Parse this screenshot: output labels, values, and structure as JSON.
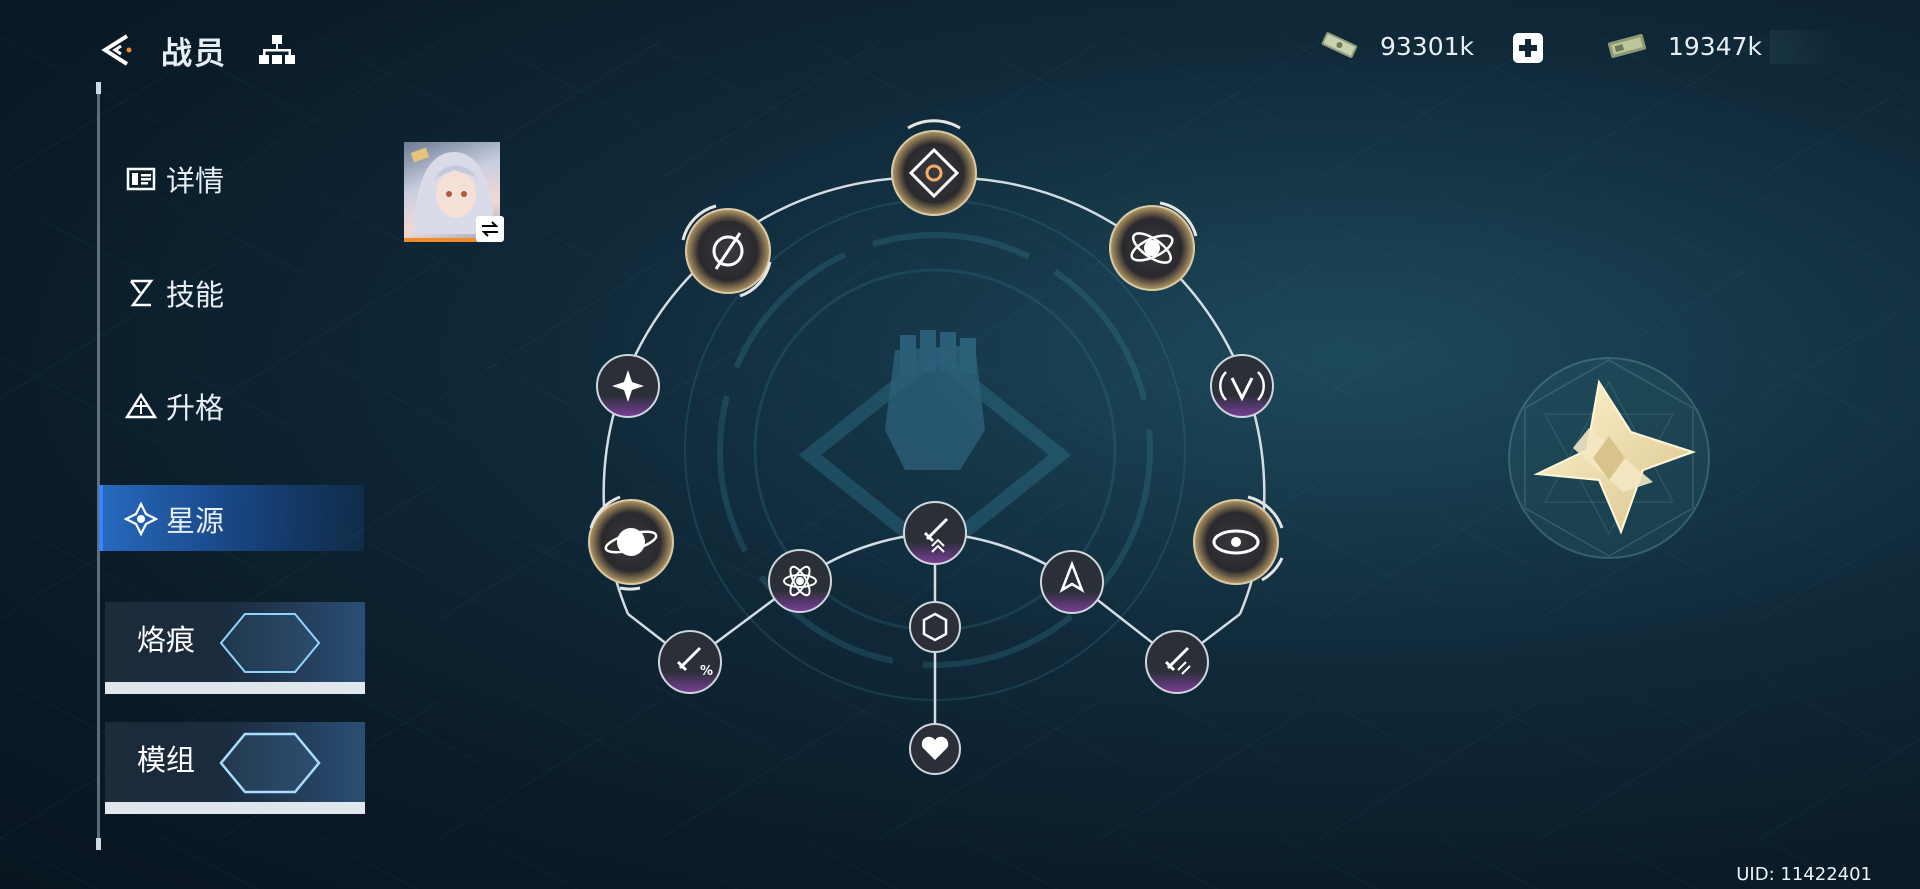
{
  "header": {
    "title": "战员",
    "back_icon": "back-arrow-icon",
    "tree_icon": "hierarchy-icon"
  },
  "currency": {
    "primary": {
      "icon": "cash-bundle-icon",
      "value": "93301k"
    },
    "secondary": {
      "icon": "ticket-icon",
      "value": "19347k"
    }
  },
  "sidebar": {
    "items": [
      {
        "label": "详情",
        "icon": "details-icon"
      },
      {
        "label": "技能",
        "icon": "skill-icon"
      },
      {
        "label": "升格",
        "icon": "ascend-icon"
      },
      {
        "label": "星源",
        "icon": "star-source-icon",
        "active": true
      }
    ],
    "cards": [
      {
        "label": "烙痕"
      },
      {
        "label": "模组"
      }
    ]
  },
  "footer": {
    "uid": "UID: 11422401"
  },
  "colors": {
    "active_nav": "#2b6fd6",
    "node_gold": "#c9a56a",
    "node_purple": "#7a4aa8",
    "background": "#0f2533"
  }
}
